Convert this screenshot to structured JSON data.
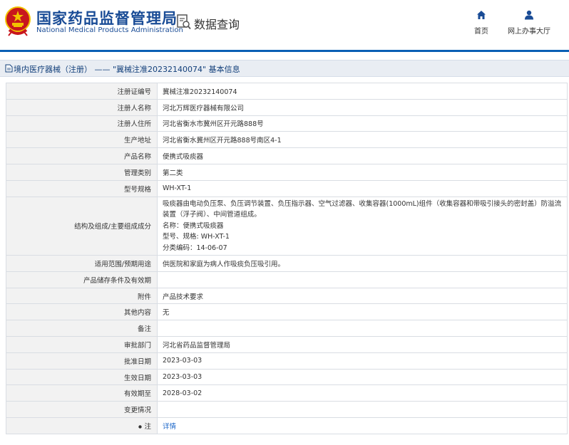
{
  "header": {
    "org_name_cn": "国家药品监督管理局",
    "org_name_en": "National Medical Products Administration",
    "page_title": "数据查询",
    "nav_home": "首页",
    "nav_hall": "网上办事大厅"
  },
  "breadcrumb": {
    "text": "境内医疗器械（注册） —— \"冀械注准20232140074\" 基本信息"
  },
  "table": {
    "labels": {
      "reg_no": "注册证编号",
      "registrant": "注册人名称",
      "address": "注册人住所",
      "production_address": "生产地址",
      "product_name": "产品名称",
      "category": "管理类别",
      "model": "型号规格",
      "structure": "结构及组成/主要组成成分",
      "scope": "适用范围/预期用途",
      "storage": "产品储存条件及有效期",
      "attachment": "附件",
      "other": "其他内容",
      "remarks": "备注",
      "approval_dept": "审批部门",
      "approval_date": "批准日期",
      "effective_date": "生效日期",
      "expiry_date": "有效期至",
      "change": "变更情况",
      "note": "注"
    },
    "values": {
      "reg_no": "冀械注准20232140074",
      "registrant": "河北万辉医疗器械有限公司",
      "address": "河北省衡水市冀州区开元路888号",
      "production_address": "河北省衡水冀州区开元路888号南区4-1",
      "product_name": "便携式吸痰器",
      "category": "第二类",
      "model": "WH-XT-1",
      "structure_lines": [
        "吸痰器由电动负压泵、负压调节装置、负压指示器、空气过滤器、收集容器(1000mL)组件（收集容器和带吸引接头的密封盖）防溢流",
        "装置（浮子阀）、中间管道组成。",
        "名称：便携式吸痰器",
        "型号、规格: WH-XT-1",
        "分类编码：14-06-07"
      ],
      "scope": "供医院和家庭为病人作吸痰负压吸引用。",
      "storage": "",
      "attachment": "产品技术要求",
      "other": "无",
      "remarks": "",
      "approval_dept": "河北省药品监督管理局",
      "approval_date": "2023-03-03",
      "effective_date": "2023-03-03",
      "expiry_date": "2028-03-02",
      "change": "",
      "note_link": "详情"
    }
  },
  "colors": {
    "brand_blue": "#1a4c96",
    "header_line": "#0a5fb4",
    "link_blue": "#1b66c8",
    "emblem_red": "#c8161d",
    "emblem_gold": "#f2c200"
  }
}
